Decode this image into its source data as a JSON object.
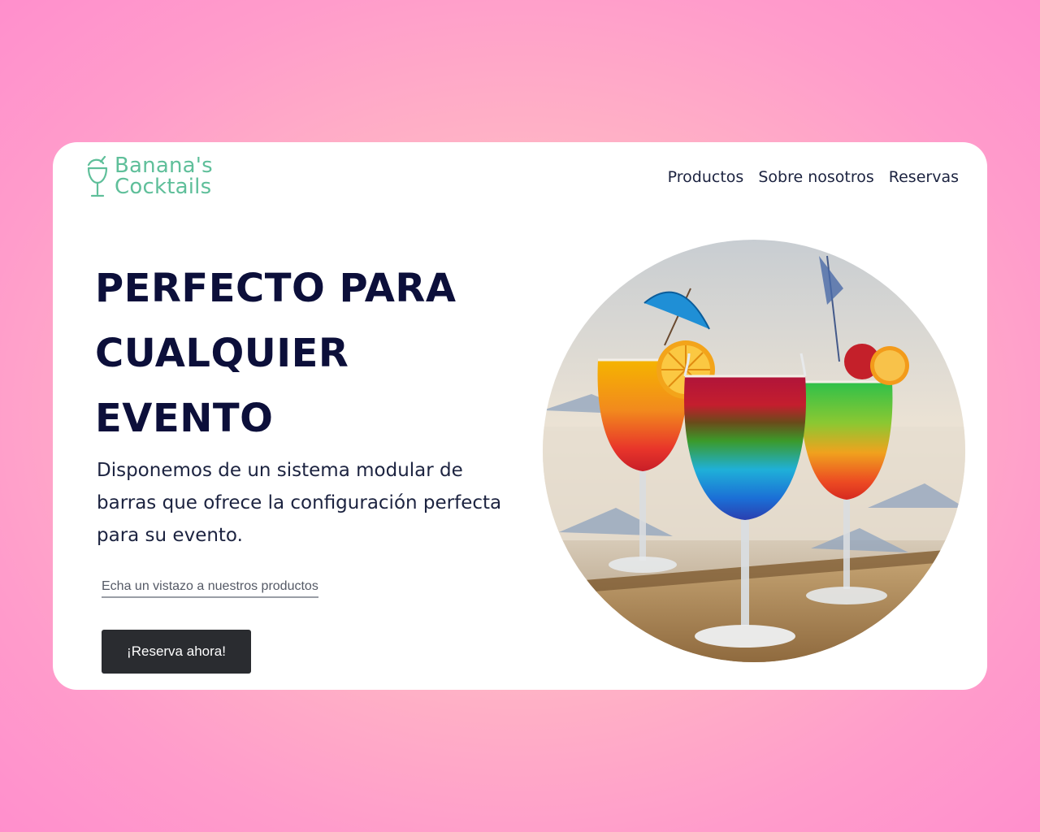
{
  "brand": {
    "line1": "Banana's",
    "line2": "Cocktails",
    "color": "#5fbf9a"
  },
  "nav": {
    "items": [
      "Productos",
      "Sobre nosotros",
      "Reservas"
    ]
  },
  "hero": {
    "title": "PERFECTO PARA CUALQUIER EVENTO",
    "description": "Disponemos de un sistema modular de barras que ofrece la configuración perfecta para su evento.",
    "products_link": "Echa un vistazo a nuestros productos",
    "cta_label": "¡Reserva ahora!",
    "image_name": "cocktails-photo"
  },
  "colors": {
    "title": "#0c0f3a",
    "button": "#2a2c30"
  }
}
